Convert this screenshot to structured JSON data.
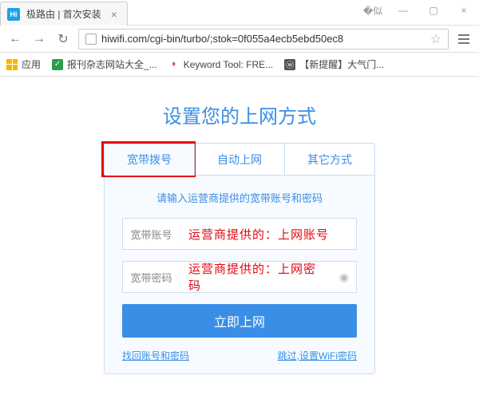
{
  "browser": {
    "tab_title": "极路由 | 首次安装",
    "url": "hiwifi.com/cgi-bin/turbo/;stok=0f055a4ecb5ebd50ec8",
    "bookmarks": {
      "apps": "应用",
      "items": [
        {
          "label": "报刊杂志网站大全_...",
          "color": "#2e9b4f"
        },
        {
          "label": "Keyword Tool: FRE...",
          "color": "#d9534f"
        },
        {
          "label": "【新提醒】大气门...",
          "color": "#555"
        }
      ]
    }
  },
  "page": {
    "heading": "设置您的上网方式",
    "tabs": [
      "宽带拨号",
      "自动上网",
      "其它方式"
    ],
    "active_tab": 0,
    "hint": "请输入运营商提供的宽带账号和密码",
    "fields": {
      "account_label": "宽带账号",
      "account_value": "运营商提供的：上网账号",
      "password_label": "宽带密码",
      "password_value": "运营商提供的：上网密码"
    },
    "submit": "立即上网",
    "link_left": "找回账号和密码",
    "link_right": "跳过,设置WiFi密码"
  }
}
